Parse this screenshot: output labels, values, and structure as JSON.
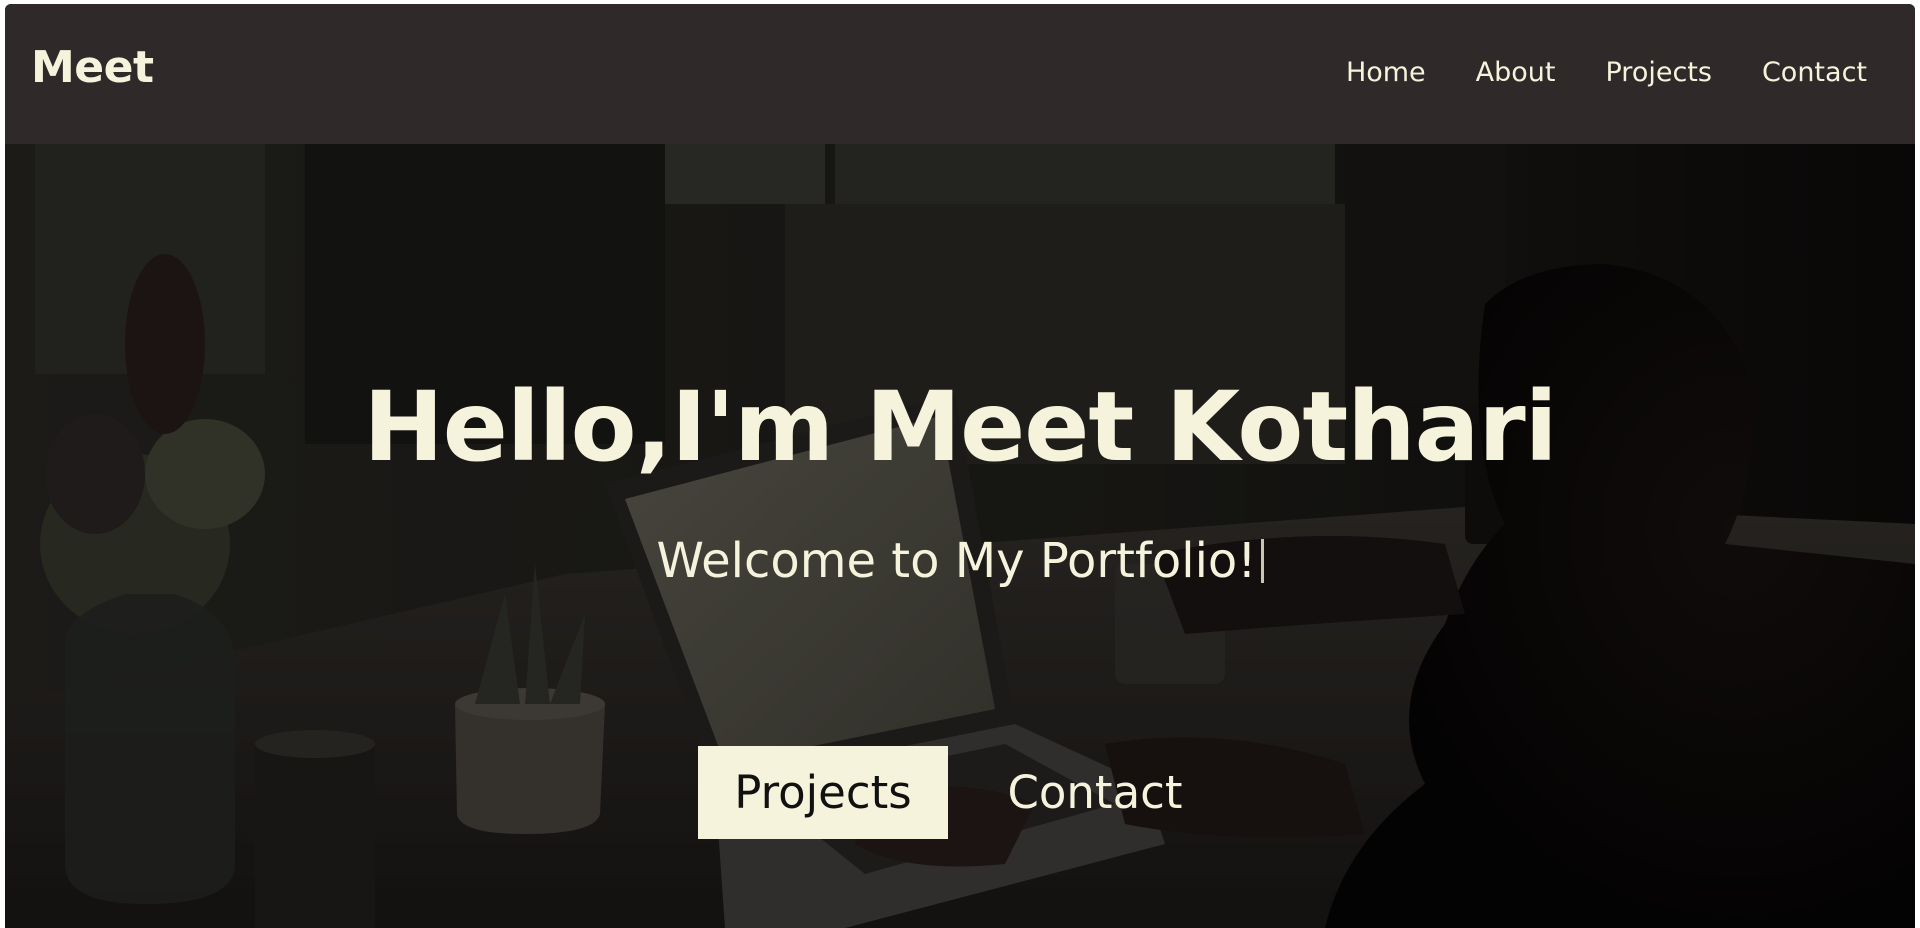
{
  "navbar": {
    "brand": "Meet",
    "links": [
      {
        "label": "Home"
      },
      {
        "label": "About"
      },
      {
        "label": "Projects"
      },
      {
        "label": "Contact"
      }
    ]
  },
  "hero": {
    "title": "Hello,I'm Meet Kothari",
    "subtitle": "Welcome to My Portfolio!",
    "buttons": {
      "primary": "Projects",
      "secondary": "Contact"
    }
  },
  "colors": {
    "navbar_bg": "#2f2a29",
    "text_cream": "#f5f3dc",
    "button_bg": "#f5f3dc"
  }
}
